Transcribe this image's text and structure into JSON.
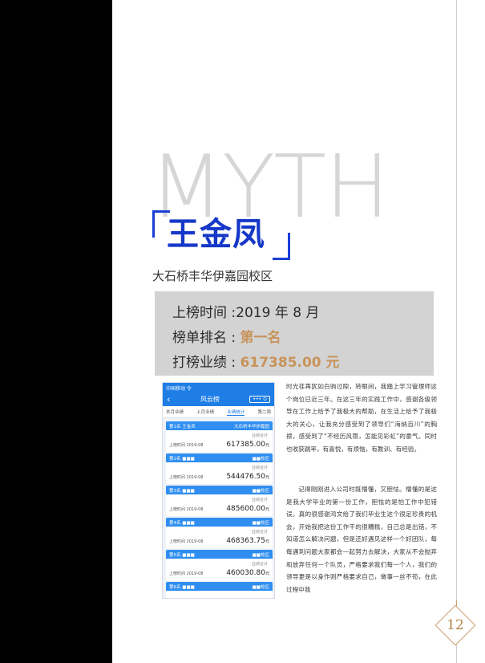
{
  "header": {
    "background_word": "MYTH",
    "name": "王金凤",
    "campus": "大石桥丰华伊嘉园校区"
  },
  "ranking": {
    "time_label": "上榜时间 :",
    "time_value": "2019 年 8 月",
    "rank_label": "榜单排名 : ",
    "rank_value": "第一名",
    "perf_label": "打榜业绩 : ",
    "perf_value": "617385.00 元"
  },
  "phone": {
    "status": "中国移动 令",
    "title": "风云榜",
    "menu": "••• ⊙",
    "tabs": [
      "本月业绩",
      "上月业绩",
      "业绩统计",
      "第二周"
    ],
    "cards": [
      {
        "head": "第1名 王金凤",
        "head_right": "大石桥丰华伊嘉园",
        "sub": "业绩合计",
        "date": "上榜时间 2019-08",
        "amount": "617385.00",
        "unit": "元"
      },
      {
        "head": "第2名 ■■■",
        "head_right": "■■校区",
        "sub": "业绩合计",
        "date": "上榜时间 2019-08",
        "amount": "544476.50",
        "unit": "元"
      },
      {
        "head": "第3名 ■■■",
        "head_right": "■■校区",
        "sub": "业绩合计",
        "date": "上榜时间 2019-08",
        "amount": "485600.00",
        "unit": "元"
      },
      {
        "head": "第4名 ■■■",
        "head_right": "■■校区",
        "sub": "业绩合计",
        "date": "上榜时间 2019-08",
        "amount": "468363.75",
        "unit": "元"
      },
      {
        "head": "第5名 ■■■",
        "head_right": "■■校区",
        "sub": "业绩合计",
        "date": "上榜时间 2019-08",
        "amount": "460030.80",
        "unit": "元"
      },
      {
        "head": "第6名 ■■■",
        "head_right": "■■校区",
        "sub": "",
        "date": "",
        "amount": "",
        "unit": ""
      }
    ]
  },
  "article": {
    "p1": "时光荏苒犹如白驹过隙，转眼间，我踏上学习管理师这个岗位已近三年。在这三年的实践工作中，感谢各级领导在工作上给予了我极大的帮助，在生活上给予了我极大的关心，让我充分感受到了领导们“海纳百川”的胸襟，感受到了“不经历风雨，怎能见彩虹”的豪气。同时也收获跳率，有喜悦，有烦恼，有教训、有经验。",
    "p2": "记得刚刚进入公司时既懵懂，又胆怯。懵懂的是这是我大学毕业的第一份工作，胆怯的是怕工作中犯错误。真的很感谢鸿文给了我们毕业生这个很足珍贵的机会，开始我把这份工作干的很糟糕，自己总是出错，不知道怎么解决问题，但是还好遇见这样一个好团队，每每遇到问题大家都会一起努力去解决，大家从不会抛弃和放弃任何一个队员，严格要求我们每一个人，我们的领导更是以身作则严格要求自己，做事一丝不苟，在此过程中我"
  },
  "page_number": "12",
  "colors": {
    "name_blue": "#1638c9",
    "accent_gold": "#c8935a",
    "info_gray": "#d3d3d3"
  }
}
